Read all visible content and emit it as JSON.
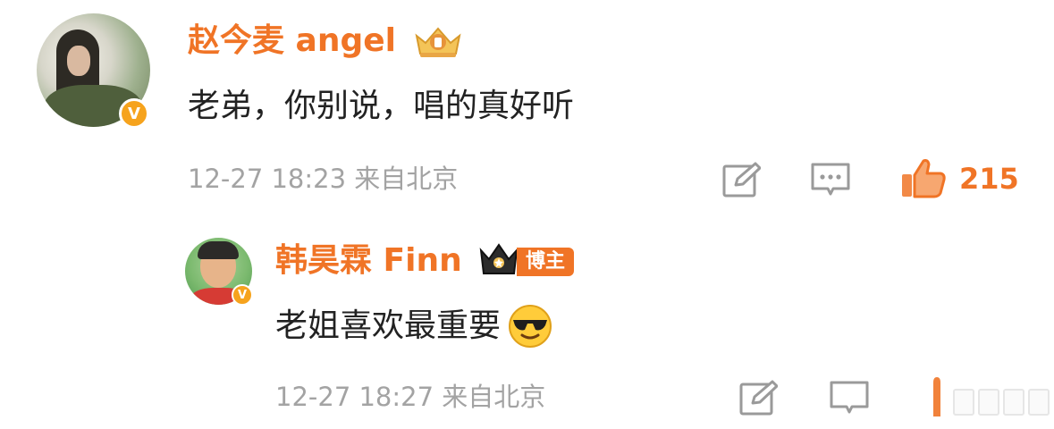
{
  "comments": [
    {
      "author": "赵今麦 angel",
      "text": "老弟，你别说，唱的真好听",
      "timestamp": "12-27 18:23",
      "location": "来自北京",
      "likes": "215",
      "verified_badge": "V",
      "icons": [
        "vip-crown-icon",
        "repost-icon",
        "comment-icon",
        "like-icon"
      ],
      "accent_color": "#f07426"
    },
    {
      "author": "韩昊霖 Finn",
      "badge": "博主",
      "text": "老姐喜欢最重要",
      "emoji": "sunglasses-emoji",
      "timestamp": "12-27 18:27",
      "location": "来自北京",
      "verified_badge": "V",
      "icons": [
        "crown-icon",
        "repost-icon",
        "comment-icon",
        "like-icon"
      ]
    }
  ]
}
